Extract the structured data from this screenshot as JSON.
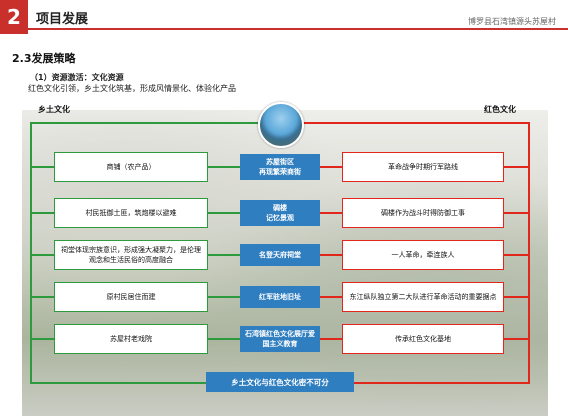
{
  "header": {
    "section_number": "2",
    "title": "项目发展",
    "project_name": "博罗县石湾镇源头苏屋村"
  },
  "strategy": {
    "title": "2.3发展策略",
    "subtitle": "（1）资源激活：文化资源",
    "description": "红色文化引领，乡土文化筑基，形成风情景化、体验化产品"
  },
  "diagram": {
    "left_label": "乡土文化",
    "right_label": "红色文化",
    "left_items": [
      "商铺（农产品）",
      "村民抵御土匪，筑炮楼以避难",
      "祠堂体现宗族意识，形成强大凝聚力，是伦理观念和生活民俗的高度融合",
      "原村民居住而建",
      "苏屋村老戏院"
    ],
    "center_items": [
      "苏屋街区\n再现繁荣商街",
      "碉楼\n记忆景观",
      "名登天府祠堂",
      "红军驻地旧址",
      "石湾镇红色文化展厅爱国主义教育"
    ],
    "right_items": [
      "革命战争时期行军路线",
      "碉楼作为战斗时得防御工事",
      "一人革命，牵连族人",
      "东江纵队独立第二大队进行革命活动的重要据点",
      "传承红色文化基地"
    ],
    "conclusion": "乡土文化与红色文化密不可分"
  },
  "colors": {
    "accent_red": "#c9302c",
    "green_line": "#2e9a3e",
    "red_line": "#e1261c",
    "center_blue": "#2f7ec0"
  }
}
